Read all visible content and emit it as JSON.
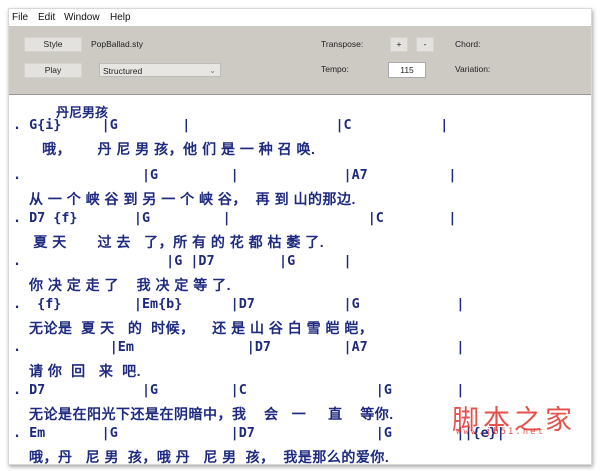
{
  "menu": [
    "File",
    "Edit",
    "Window",
    "Help"
  ],
  "toolbar": {
    "style_button": "Style",
    "style_file": "PopBallad.sty",
    "play_button": "Play",
    "mode_select": "Structured",
    "transpose_label": "Transpose:",
    "plus": "+",
    "minus": "-",
    "chord_label": "Chord:",
    "tempo_label": "Tempo:",
    "tempo_value": "115",
    "variation_label": "Variation:"
  },
  "song": {
    "title": "丹尼男孩",
    "chords": [
      ". G{i}     |G        |                  |C           |",
      ".               |G         |             |A7          |",
      ". D7 {f}       |G         |                 |C        |",
      ".                  |G |D7        |G      |",
      ".  {f}         |Em{b}      |D7           |G            |",
      ".           |Em              |D7         |A7           |",
      ". D7            |G         |C                |G        |",
      ". Em       |G              |D7               |G        ||{e}|"
    ],
    "lyrics": [
      "   哦，      丹 尼 男 孩，他 们 是 一 种 召 唤.",
      "从 一 个 峡 谷 到 另 一 个 峡 谷，  再 到 山的那边.",
      " 夏 天       过 去   了，所 有 的 花 都 枯 萎 了.",
      "你 决 定 走 了    我 决 定 等 了.",
      "无论是  夏 天   的  时候，    还 是 山 谷 白 雪 皑 皑，",
      "请 你  回   来  吧.",
      "无论是在阳光下还是在阴暗中，我    会   一     直    等你.",
      "哦，丹   尼 男  孩，哦 丹   尼 男  孩，  我是那么的爱你."
    ]
  },
  "watermark": {
    "cn": "脚本之家",
    "url": "www.jb51.net"
  }
}
